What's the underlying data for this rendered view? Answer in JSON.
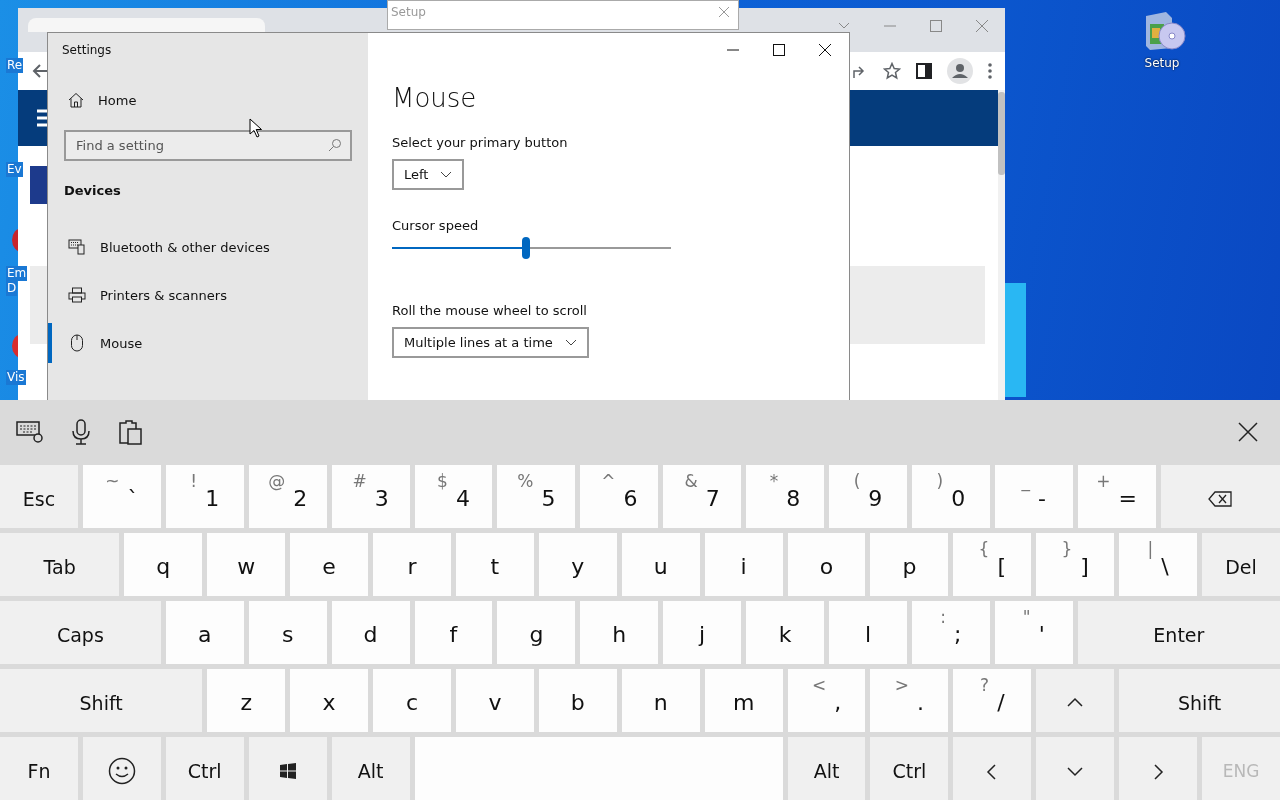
{
  "desktop": {
    "left_icons": [
      {
        "lines": [
          "Re"
        ]
      },
      {
        "lines": [
          "Ev"
        ]
      },
      {
        "lines": [
          "Em",
          "D"
        ]
      },
      {
        "lines": [
          "Vis"
        ]
      }
    ],
    "setup_icon": {
      "label": "Setup"
    }
  },
  "setup_window": {
    "title": "Setup"
  },
  "settings": {
    "title": "Settings",
    "home": "Home",
    "search": {
      "placeholder": "Find a setting"
    },
    "section": "Devices",
    "nav": [
      {
        "label": "Bluetooth & other devices",
        "kind": "devices",
        "selected": false
      },
      {
        "label": "Printers & scanners",
        "kind": "printer",
        "selected": false
      },
      {
        "label": "Mouse",
        "kind": "mouse",
        "selected": true
      }
    ],
    "page": {
      "heading": "Mouse",
      "primary_button": {
        "label": "Select your primary button",
        "value": "Left"
      },
      "cursor_speed": {
        "label": "Cursor speed",
        "level": 0.48
      },
      "wheel": {
        "label": "Roll the mouse wheel to scroll",
        "value": "Multiple lines at a time"
      }
    }
  },
  "keyboard": {
    "key_rows": [
      {
        "keys": [
          {
            "kind": "func",
            "label": "Esc",
            "disabled": false
          },
          {
            "kind": "char",
            "label": "`",
            "shift": "~",
            "disabled": false
          },
          {
            "kind": "char",
            "label": "1",
            "shift": "!",
            "disabled": false
          },
          {
            "kind": "char",
            "label": "2",
            "shift": "@",
            "disabled": false
          },
          {
            "kind": "char",
            "label": "3",
            "shift": "#",
            "disabled": false
          },
          {
            "kind": "char",
            "label": "4",
            "shift": "$",
            "disabled": false
          },
          {
            "kind": "char",
            "label": "5",
            "shift": "%",
            "disabled": false
          },
          {
            "kind": "char",
            "label": "6",
            "shift": "^",
            "disabled": false
          },
          {
            "kind": "char",
            "label": "7",
            "shift": "&",
            "disabled": false
          },
          {
            "kind": "char",
            "label": "8",
            "shift": "*",
            "disabled": false
          },
          {
            "kind": "char",
            "label": "9",
            "shift": "(",
            "disabled": false
          },
          {
            "kind": "char",
            "label": "0",
            "shift": ")",
            "disabled": false
          },
          {
            "kind": "char",
            "label": "-",
            "shift": "_",
            "disabled": false
          },
          {
            "kind": "char",
            "label": "=",
            "shift": "+",
            "disabled": false
          },
          {
            "kind": "backspace"
          }
        ]
      },
      {
        "keys": [
          {
            "kind": "func",
            "label": "Tab",
            "disabled": false
          },
          {
            "kind": "char",
            "label": "q",
            "disabled": false
          },
          {
            "kind": "char",
            "label": "w",
            "disabled": false
          },
          {
            "kind": "char",
            "label": "e",
            "disabled": false
          },
          {
            "kind": "char",
            "label": "r",
            "disabled": false
          },
          {
            "kind": "char",
            "label": "t",
            "disabled": false
          },
          {
            "kind": "char",
            "label": "y",
            "disabled": false
          },
          {
            "kind": "char",
            "label": "u",
            "disabled": false
          },
          {
            "kind": "char",
            "label": "i",
            "disabled": false
          },
          {
            "kind": "char",
            "label": "o",
            "disabled": false
          },
          {
            "kind": "char",
            "label": "p",
            "disabled": false
          },
          {
            "kind": "char",
            "label": "[",
            "shift": "{",
            "disabled": false
          },
          {
            "kind": "char",
            "label": "]",
            "shift": "}",
            "disabled": false
          },
          {
            "kind": "char",
            "label": "\\",
            "shift": "|",
            "disabled": false
          },
          {
            "kind": "func",
            "label": "Del",
            "disabled": false
          }
        ]
      },
      {
        "keys": [
          {
            "kind": "func",
            "label": "Caps",
            "disabled": false
          },
          {
            "kind": "char",
            "label": "a",
            "disabled": false
          },
          {
            "kind": "char",
            "label": "s",
            "disabled": false
          },
          {
            "kind": "char",
            "label": "d",
            "disabled": false
          },
          {
            "kind": "char",
            "label": "f",
            "disabled": false
          },
          {
            "kind": "char",
            "label": "g",
            "disabled": false
          },
          {
            "kind": "char",
            "label": "h",
            "disabled": false
          },
          {
            "kind": "char",
            "label": "j",
            "disabled": false
          },
          {
            "kind": "char",
            "label": "k",
            "disabled": false
          },
          {
            "kind": "char",
            "label": "l",
            "disabled": false
          },
          {
            "kind": "char",
            "label": ";",
            "shift": ":",
            "disabled": false
          },
          {
            "kind": "char",
            "label": "'",
            "shift": "\"",
            "disabled": false
          },
          {
            "kind": "func",
            "label": "Enter",
            "disabled": false
          }
        ]
      },
      {
        "keys": [
          {
            "kind": "func",
            "label": "Shift",
            "disabled": false
          },
          {
            "kind": "char",
            "label": "z",
            "disabled": false
          },
          {
            "kind": "char",
            "label": "x",
            "disabled": false
          },
          {
            "kind": "char",
            "label": "c",
            "disabled": false
          },
          {
            "kind": "char",
            "label": "v",
            "disabled": false
          },
          {
            "kind": "char",
            "label": "b",
            "disabled": false
          },
          {
            "kind": "char",
            "label": "n",
            "disabled": false
          },
          {
            "kind": "char",
            "label": "m",
            "disabled": false
          },
          {
            "kind": "char",
            "label": ",",
            "shift": "<",
            "disabled": false
          },
          {
            "kind": "char",
            "label": ".",
            "shift": ">",
            "disabled": false
          },
          {
            "kind": "char",
            "label": "/",
            "shift": "?",
            "disabled": false
          },
          {
            "kind": "up"
          },
          {
            "kind": "func",
            "label": "Shift",
            "disabled": false
          }
        ]
      },
      {
        "keys": [
          {
            "kind": "func",
            "label": "Fn",
            "disabled": false
          },
          {
            "kind": "emoji"
          },
          {
            "kind": "func",
            "label": "Ctrl",
            "disabled": false
          },
          {
            "kind": "windows"
          },
          {
            "kind": "func",
            "label": "Alt",
            "disabled": false
          },
          {
            "kind": "space"
          },
          {
            "kind": "func",
            "label": "Alt",
            "disabled": false
          },
          {
            "kind": "func",
            "label": "Ctrl",
            "disabled": false
          },
          {
            "kind": "left"
          },
          {
            "kind": "down"
          },
          {
            "kind": "right"
          },
          {
            "kind": "func",
            "label": "ENG",
            "disabled": true
          }
        ]
      }
    ]
  }
}
